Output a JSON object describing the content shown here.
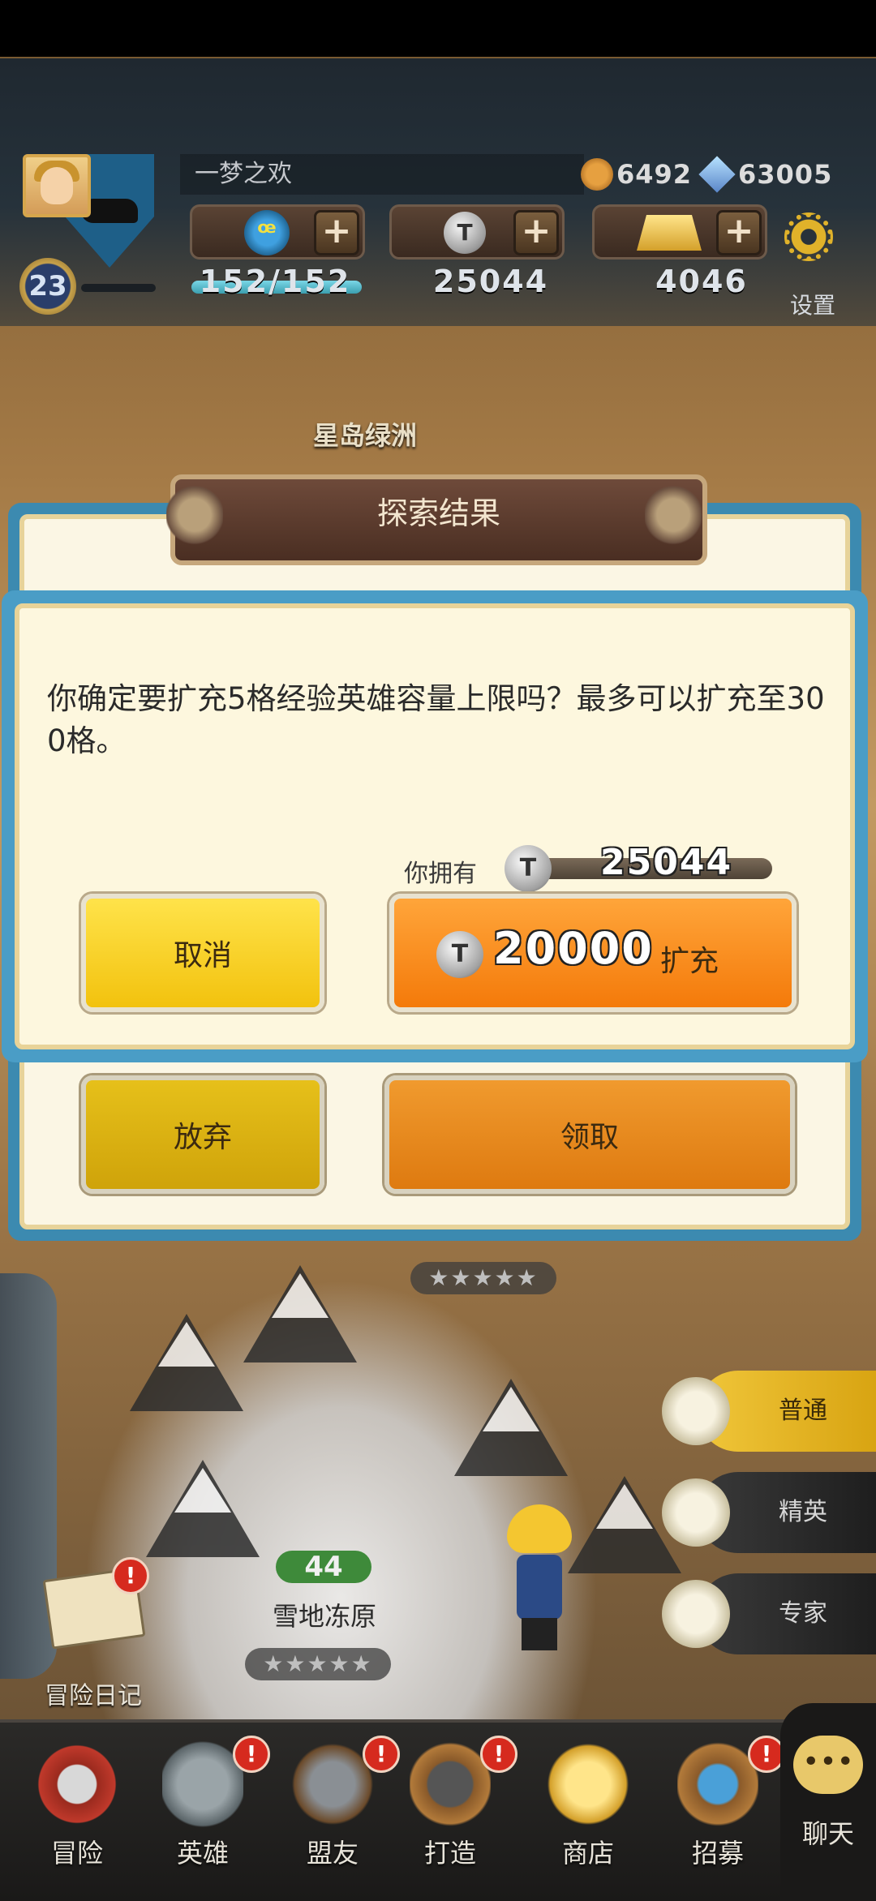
{
  "player": {
    "name": "一梦之欢",
    "level": "23",
    "medals": "6492",
    "gems": "63005"
  },
  "resources": {
    "stamina": "152/152",
    "silver": "25044",
    "gold": "4046",
    "plus": "+",
    "coin_symbol": "T"
  },
  "settings_label": "设置",
  "location": "星岛绿洲",
  "explore_dialog": {
    "title": "探索结果",
    "abandon": "放弃",
    "claim": "领取"
  },
  "confirm_dialog": {
    "message": "你确定要扩充5格经验英雄容量上限吗？最多可以扩充至300格。",
    "owned_label": "你拥有",
    "owned_value": "25044",
    "cancel": "取消",
    "expand_cost": "20000",
    "expand": "扩充"
  },
  "map": {
    "stars_top": "★★★★★",
    "snow_level": "44",
    "snow_name": "雪地冻原",
    "snow_stars": "★★★★★",
    "diary_label": "冒险日记",
    "badge": "!"
  },
  "difficulty": {
    "normal": "普通",
    "elite": "精英",
    "expert": "专家"
  },
  "nav": {
    "adventure": "冒险",
    "heroes": "英雄",
    "alliance": "盟友",
    "forge": "打造",
    "shop": "商店",
    "recruit": "招募",
    "chat": "聊天",
    "chat_dots": "•••"
  }
}
